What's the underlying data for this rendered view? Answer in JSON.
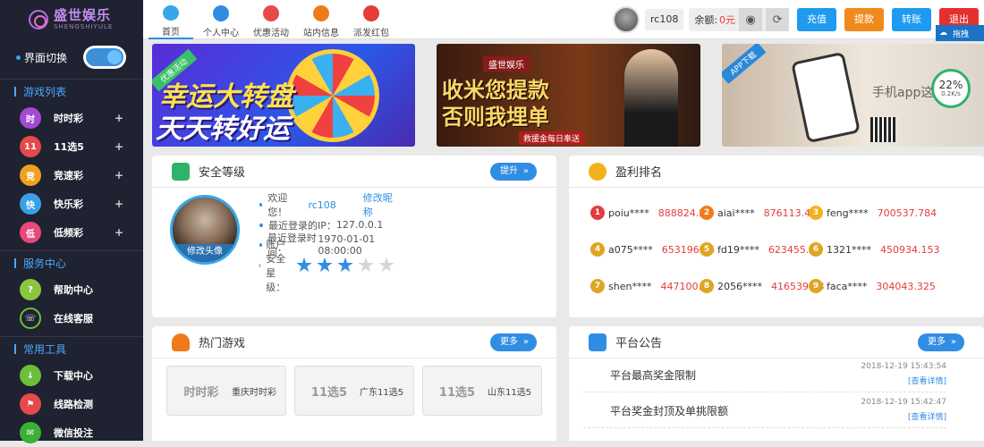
{
  "sidebar": {
    "logo_cn": "盛世娱乐",
    "logo_en": "SHENGSHIYULE",
    "switch_label": "界面切换",
    "sections": {
      "games": "游戏列表",
      "service": "服务中心",
      "tools": "常用工具"
    },
    "games": [
      {
        "label": "时时彩",
        "icon": "ssc-icon",
        "color": "#a349d6",
        "glyph": "时"
      },
      {
        "label": "11选5",
        "icon": "11x5-icon",
        "color": "#e54a4a",
        "glyph": "11"
      },
      {
        "label": "竞速彩",
        "icon": "race-icon",
        "color": "#f0a020",
        "glyph": "竞"
      },
      {
        "label": "快乐彩",
        "icon": "happy-icon",
        "color": "#3aa0e8",
        "glyph": "快"
      },
      {
        "label": "低频彩",
        "icon": "lowfreq-icon",
        "color": "#e8487a",
        "glyph": "低"
      }
    ],
    "service": [
      {
        "label": "帮助中心",
        "icon": "help-icon",
        "color": "#8cc63f",
        "glyph": "?"
      },
      {
        "label": "在线客服",
        "icon": "headset-icon",
        "color": "#1f2230",
        "glyph": "☏"
      }
    ],
    "tools": [
      {
        "label": "下载中心",
        "icon": "download-icon",
        "color": "#6cbf3a",
        "glyph": "↓"
      },
      {
        "label": "线路检测",
        "icon": "route-icon",
        "color": "#e54a4a",
        "glyph": "⚑"
      },
      {
        "label": "微信投注",
        "icon": "wechat-icon",
        "color": "#3cb035",
        "glyph": "✉"
      }
    ]
  },
  "topbar": {
    "tabs": [
      {
        "label": "首页",
        "color": "#35a8e8"
      },
      {
        "label": "个人中心",
        "color": "#2f8de4"
      },
      {
        "label": "优惠活动",
        "color": "#e54a4a"
      },
      {
        "label": "站内信息",
        "color": "#f07a1a"
      },
      {
        "label": "派发红包",
        "color": "#e53b3b"
      }
    ],
    "username": "rc108",
    "balance_label": "余额:",
    "balance_value": "0元",
    "buttons": {
      "recharge": "充值",
      "withdraw": "提款",
      "transfer": "转账",
      "logout": "退出"
    },
    "float_label": "拖拽"
  },
  "banners": {
    "b1_line1": "幸运大转盘",
    "b1_line2": "天天转好运",
    "b1_tag": "优惠活动",
    "b2_brand": "盛世娱乐",
    "b2_line1": "收米您提款",
    "b2_line2": "否则我埋单",
    "b2_sub": "救援金每日奉送",
    "b3_tag": "APP下载",
    "b3_text": "手机app这",
    "b3_percent": "22%",
    "b3_speed": "0.2K/s"
  },
  "security": {
    "title": "安全等级",
    "more": "提升",
    "avatar_caption": "修改头像",
    "welcome": "欢迎您！",
    "username": "rc108",
    "edit_nick": "修改昵称",
    "ip_label": "最近登录的IP：",
    "ip": "127.0.0.1",
    "time_label": "最近登录时间：",
    "time": "1970-01-01 08:00:00",
    "stars_label": "账户安全星级：",
    "stars": 3,
    "stars_max": 5
  },
  "ranking": {
    "title": "盈利排名",
    "items": [
      {
        "n": "1",
        "name": "poiu****",
        "amount": "888824.25"
      },
      {
        "n": "2",
        "name": "aiai****",
        "amount": "876113.487"
      },
      {
        "n": "3",
        "name": "feng****",
        "amount": "700537.784"
      },
      {
        "n": "4",
        "name": "a075****",
        "amount": "653196.54"
      },
      {
        "n": "5",
        "name": "fd19****",
        "amount": "623455.34"
      },
      {
        "n": "6",
        "name": "1321****",
        "amount": "450934.153"
      },
      {
        "n": "7",
        "name": "shen****",
        "amount": "447100.78"
      },
      {
        "n": "8",
        "name": "2056****",
        "amount": "416539.13"
      },
      {
        "n": "9",
        "name": "faca****",
        "amount": "304043.325"
      }
    ]
  },
  "hot_games": {
    "title": "热门游戏",
    "more": "更多",
    "items": [
      {
        "logo": "时时彩",
        "name": "重庆时时彩"
      },
      {
        "logo": "11选5",
        "name": "广东11选5"
      },
      {
        "logo": "11选5",
        "name": "山东11选5"
      }
    ]
  },
  "notices": {
    "title": "平台公告",
    "more": "更多",
    "items": [
      {
        "title": "平台最高奖金限制",
        "date": "2018-12-19 15:43:54",
        "link": "[查看详情]"
      },
      {
        "title": "平台奖金封顶及单挑限额",
        "date": "2018-12-19 15:42:47",
        "link": "[查看详情]"
      }
    ]
  }
}
